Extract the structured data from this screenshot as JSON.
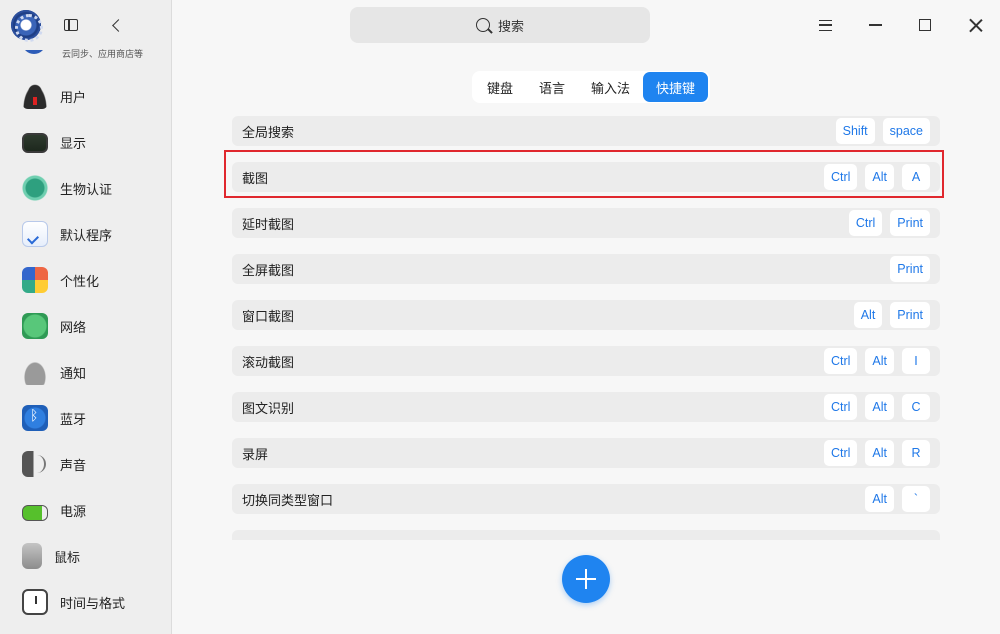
{
  "sidebar": {
    "account_subtitle": "云同步、应用商店等",
    "items": [
      {
        "label": "用户",
        "icon": "user-icon"
      },
      {
        "label": "显示",
        "icon": "display-icon"
      },
      {
        "label": "生物认证",
        "icon": "fingerprint-icon"
      },
      {
        "label": "默认程序",
        "icon": "default-apps-icon"
      },
      {
        "label": "个性化",
        "icon": "palette-icon"
      },
      {
        "label": "网络",
        "icon": "network-icon"
      },
      {
        "label": "通知",
        "icon": "bell-icon"
      },
      {
        "label": "蓝牙",
        "icon": "bluetooth-icon"
      },
      {
        "label": "声音",
        "icon": "speaker-icon"
      },
      {
        "label": "电源",
        "icon": "battery-icon"
      },
      {
        "label": "鼠标",
        "icon": "mouse-icon"
      },
      {
        "label": "时间与格式",
        "icon": "clock-icon"
      }
    ]
  },
  "search": {
    "placeholder": "搜索"
  },
  "tabs": [
    "键盘",
    "语言",
    "输入法",
    "快捷键"
  ],
  "active_tab": "快捷键",
  "shortcuts": [
    {
      "name": "全局搜索",
      "keys": [
        "Shift",
        "space"
      ]
    },
    {
      "name": "截图",
      "keys": [
        "Ctrl",
        "Alt",
        "A"
      ]
    },
    {
      "name": "延时截图",
      "keys": [
        "Ctrl",
        "Print"
      ]
    },
    {
      "name": "全屏截图",
      "keys": [
        "Print"
      ]
    },
    {
      "name": "窗口截图",
      "keys": [
        "Alt",
        "Print"
      ]
    },
    {
      "name": "滚动截图",
      "keys": [
        "Ctrl",
        "Alt",
        "I"
      ]
    },
    {
      "name": "图文识别",
      "keys": [
        "Ctrl",
        "Alt",
        "C"
      ]
    },
    {
      "name": "录屏",
      "keys": [
        "Ctrl",
        "Alt",
        "R"
      ]
    },
    {
      "name": "切换同类型窗口",
      "keys": [
        "Alt",
        "`"
      ]
    }
  ],
  "colors": {
    "accent": "#1f84f0",
    "key_text": "#1f78e8",
    "highlight_border": "#e0282e"
  }
}
